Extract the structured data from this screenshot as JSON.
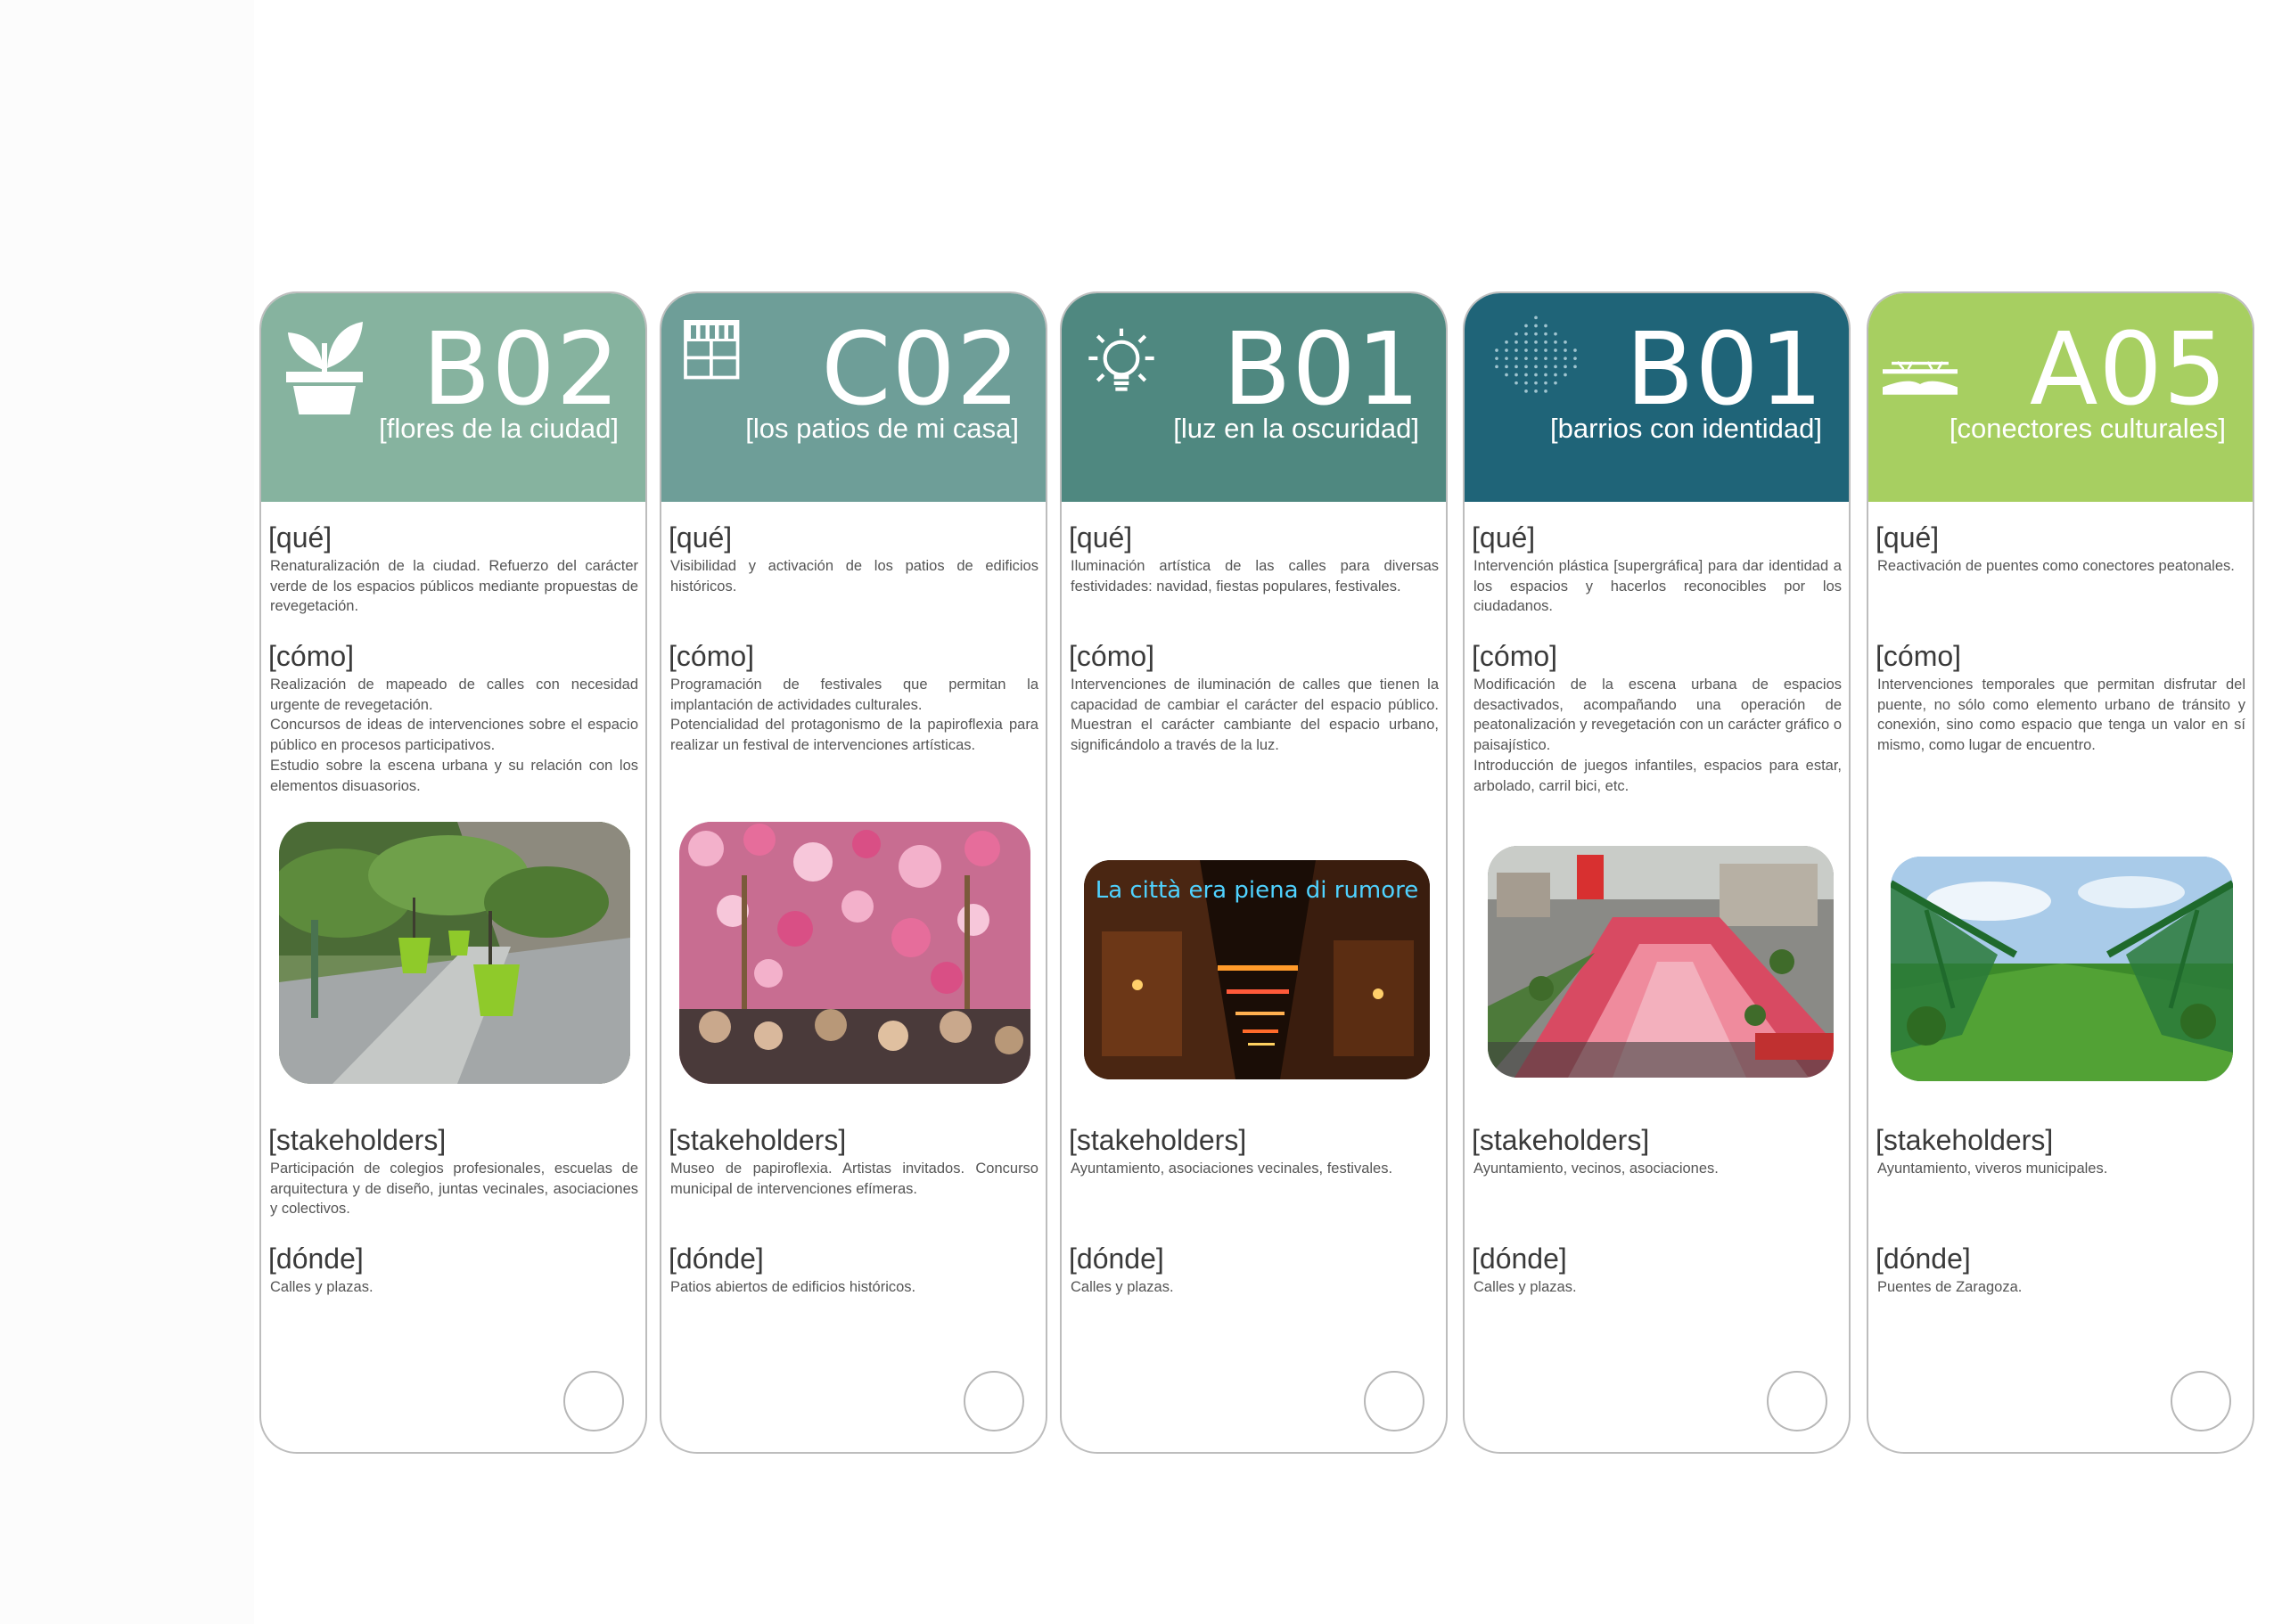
{
  "cards": [
    {
      "code": "B02",
      "subtitle": "[flores de la ciudad]",
      "color": "#86b39f",
      "icon": "plant-pot-icon",
      "que_label": "[qué]",
      "que": "Renaturalización de la ciudad. Refuerzo del carácter verde de los espacios públicos mediante propuestas de revegetación.",
      "como_label": "[cómo]",
      "como": "Realización de mapeado de calles con necesidad urgente de revegetación.\nConcursos de ideas de intervenciones sobre el espacio público en procesos participativos.\nEstudio sobre la escena urbana y su relación con los elementos disuasorios.",
      "stakeholders_label": "[stakeholders]",
      "stakeholders": "Participación de colegios profesionales, escuelas de arquitectura y de diseño, juntas vecinales, asociaciones y colectivos.",
      "donde_label": "[dónde]",
      "donde": "Calles y plazas.",
      "photo": "green-flower-pots-street-photo"
    },
    {
      "code": "C02",
      "subtitle": "[los patios de mi casa]",
      "color": "#6e9e98",
      "icon": "courtyard-building-icon",
      "que_label": "[qué]",
      "que": "Visibilidad y activación de los patios de edificios históricos.",
      "como_label": "[cómo]",
      "como": "Programación de festivales que permitan la implantación de actividades culturales.\nPotencialidad del protagonismo de la papiroflexia para realizar un festival de intervenciones artísticas.",
      "stakeholders_label": "[stakeholders]",
      "stakeholders": "Museo de papiroflexia. Artistas invitados. Concurso municipal de intervenciones efímeras.",
      "donde_label": "[dónde]",
      "donde": "Patios abiertos de edificios históricos.",
      "photo": "pink-paper-flowers-festival-photo"
    },
    {
      "code": "B01",
      "subtitle": "[luz en la oscuridad]",
      "color": "#4f8880",
      "icon": "lightbulb-icon",
      "que_label": "[qué]",
      "que": "Iluminación artística de las calles para diversas festividades: navidad, fiestas populares, festivales.",
      "como_label": "[cómo]",
      "como": "Intervenciones de iluminación de calles que tienen la capacidad de cambiar el carácter del espacio público. Muestran el carácter cambiante del espacio urbano, significándolo a través de la luz.",
      "stakeholders_label": "[stakeholders]",
      "stakeholders": "Ayuntamiento, asociaciones vecinales, festivales.",
      "donde_label": "[dónde]",
      "donde": "Calles y plazas.",
      "photo": "neon-lights-street-night-photo",
      "photo_text": "La città era piena di rumore"
    },
    {
      "code": "B01",
      "subtitle": "[barrios con identidad]",
      "color": "#1f6478",
      "icon": "dotted-pattern-icon",
      "que_label": "[qué]",
      "que": "Intervención plástica [supergráfica] para dar identidad a los espacios y hacerlos reconocibles por los ciudadanos.",
      "como_label": "[cómo]",
      "como": "Modificación de la escena urbana de espacios desactivados, acompañando una operación de peatonalización y revegetación con un carácter gráfico o paisajístico.\nIntroducción de juegos infantiles, espacios para estar, arbolado, carril bici, etc.",
      "stakeholders_label": "[stakeholders]",
      "stakeholders": "Ayuntamiento, vecinos, asociaciones.",
      "donde_label": "[dónde]",
      "donde": "Calles y plazas.",
      "photo": "red-plaza-superkilen-photo"
    },
    {
      "code": "A05",
      "subtitle": "[conectores culturales]",
      "color": "#a7cf61",
      "icon": "bridge-icon",
      "que_label": "[qué]",
      "que": "Reactivación de puentes como conectores peatonales.",
      "como_label": "[cómo]",
      "como": "Intervenciones temporales que permitan disfrutar del puente, no sólo como elemento urbano de tránsito y conexión, sino como espacio que tenga un valor en sí mismo, como lugar de encuentro.",
      "stakeholders_label": "[stakeholders]",
      "stakeholders": "Ayuntamiento, viveros municipales.",
      "donde_label": "[dónde]",
      "donde": "Puentes de Zaragoza.",
      "photo": "green-grass-bridge-photo"
    }
  ]
}
